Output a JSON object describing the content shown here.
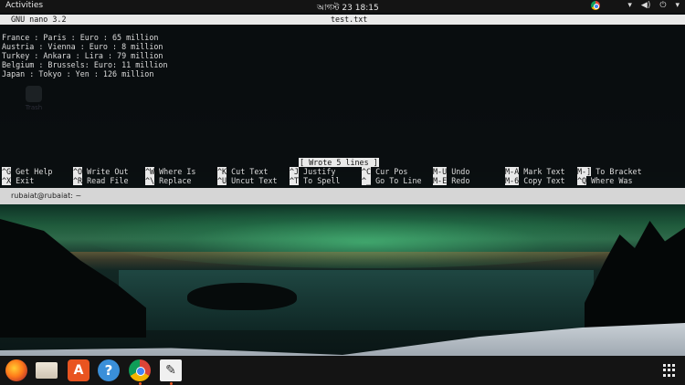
{
  "topbar": {
    "activities": "Activities",
    "clock": "আগস্ট 23  18:15",
    "tray": [
      "chrome-icon",
      "network-wifi-icon",
      "volume-icon",
      "power-icon",
      "menu-arrow-icon"
    ]
  },
  "desktop": {
    "trash_label": "Trash"
  },
  "nano": {
    "version": "GNU nano 3.2",
    "filename": "test.txt",
    "lines": [
      "France : Paris : Euro : 65 million",
      "Austria : Vienna : Euro : 8 million",
      "Turkey : Ankara : Lira : 79 million",
      "Belgium : Brussels: Euro: 11 million",
      "Japan : Tokyo : Yen : 126 million"
    ],
    "status": "[ Wrote 5 lines ]",
    "shortcuts_row1": [
      {
        "key": "^G",
        "label": "Get Help"
      },
      {
        "key": "^O",
        "label": "Write Out"
      },
      {
        "key": "^W",
        "label": "Where Is"
      },
      {
        "key": "^K",
        "label": "Cut Text"
      },
      {
        "key": "^J",
        "label": "Justify"
      },
      {
        "key": "^C",
        "label": "Cur Pos"
      },
      {
        "key": "M-U",
        "label": "Undo"
      },
      {
        "key": "M-A",
        "label": "Mark Text"
      },
      {
        "key": "M-]",
        "label": "To Bracket"
      }
    ],
    "shortcuts_row2": [
      {
        "key": "^X",
        "label": "Exit"
      },
      {
        "key": "^R",
        "label": "Read File"
      },
      {
        "key": "^\\",
        "label": "Replace"
      },
      {
        "key": "^U",
        "label": "Uncut Text"
      },
      {
        "key": "^T",
        "label": "To Spell"
      },
      {
        "key": "^_",
        "label": "Go To Line"
      },
      {
        "key": "M-E",
        "label": "Redo"
      },
      {
        "key": "M-6",
        "label": "Copy Text"
      },
      {
        "key": "^Q",
        "label": "Where Was"
      }
    ]
  },
  "terminal": {
    "tab_title": "rubaiat@rubaiat: ~"
  },
  "dock": {
    "items": [
      "firefox-icon",
      "files-icon",
      "software-center-icon",
      "help-icon",
      "chrome-icon",
      "text-editor-icon"
    ],
    "appcenter_glyph": "A",
    "help_glyph": "?",
    "editor_glyph": "✎",
    "show_apps": "show-applications-icon"
  }
}
